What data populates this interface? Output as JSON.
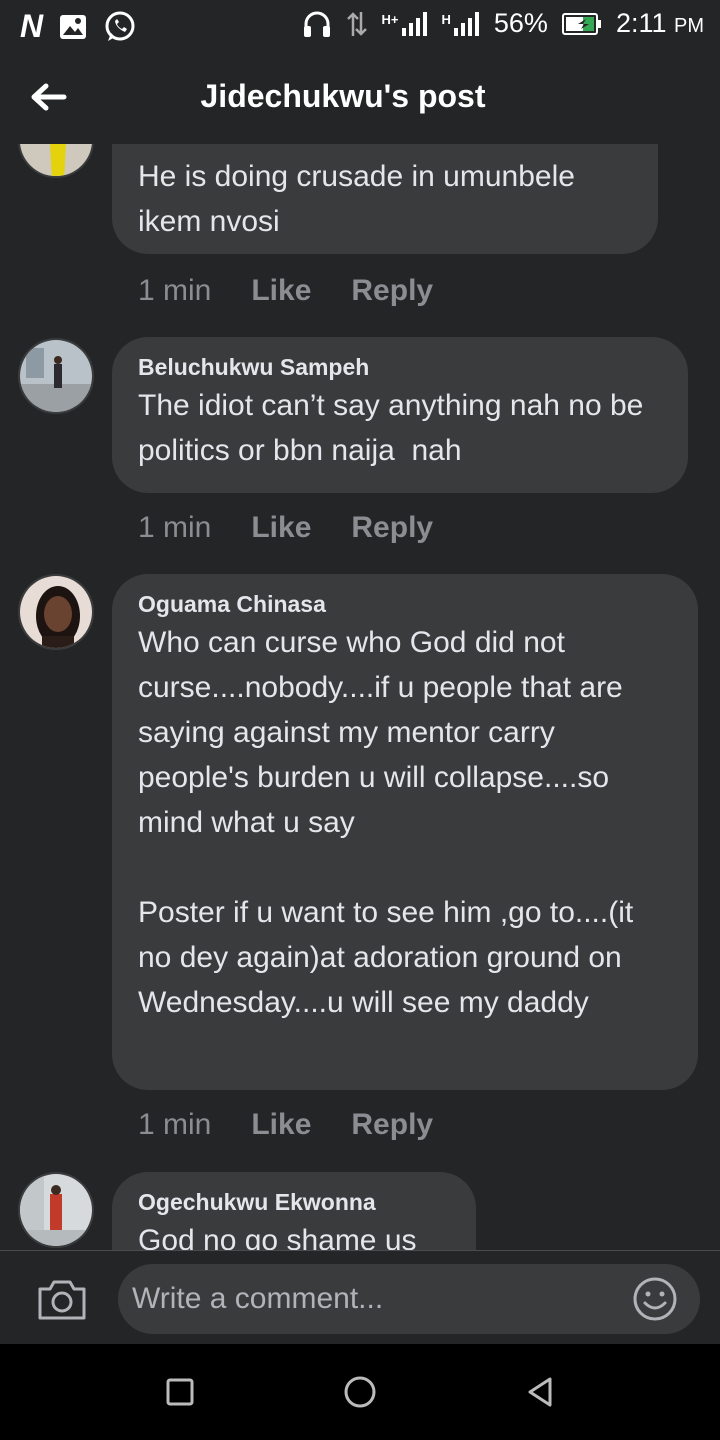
{
  "status_bar": {
    "app_letter": "N",
    "signal_1": "H+",
    "signal_2": "H",
    "battery": "56%",
    "time": "2:11",
    "ampm": "PM"
  },
  "header": {
    "title": "Jidechukwu's post"
  },
  "comments": [
    {
      "author": "",
      "text": "He is doing crusade in umunbele ikem nvosi",
      "time": "1 min",
      "like": "Like",
      "reply": "Reply"
    },
    {
      "author": "Beluchukwu Sampeh",
      "text": "The idiot can’t say anything nah no be politics or bbn naija  nah",
      "time": "1 min",
      "like": "Like",
      "reply": "Reply"
    },
    {
      "author": "Oguama Chinasa",
      "text": "Who can curse who God did not curse....nobody....if u people that are saying against my mentor carry people's burden u will collapse....so mind what u say\n\nPoster if u want to see him ,go to....(it no dey again)at adoration ground on Wednesday....u will see my daddy",
      "time": "1 min",
      "like": "Like",
      "reply": "Reply"
    },
    {
      "author": "Ogechukwu Ekwonna",
      "text": "God no go shame us"
    }
  ],
  "composer": {
    "placeholder": "Write a comment..."
  }
}
